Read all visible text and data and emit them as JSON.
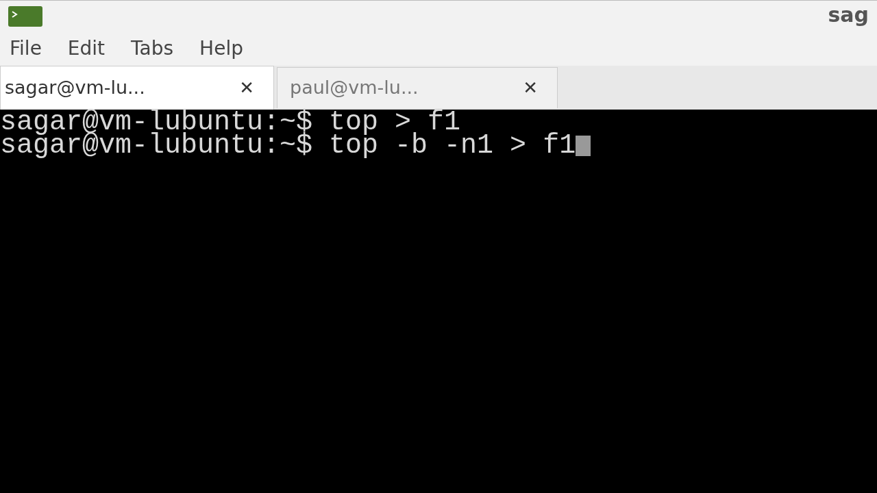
{
  "window": {
    "title": "sag"
  },
  "menu": [
    "File",
    "Edit",
    "Tabs",
    "Help"
  ],
  "tabs": [
    {
      "label": "sagar@vm-lu...",
      "close": "✕",
      "selected": true
    },
    {
      "label": "paul@vm-lu...",
      "close": "✕",
      "selected": false
    }
  ],
  "terminal": {
    "lines": [
      {
        "text": "sagar@vm-lubuntu:~$ top > f1",
        "cursor": false
      },
      {
        "text": "sagar@vm-lubuntu:~$ top -b -n1 > f1",
        "cursor": true
      }
    ]
  }
}
